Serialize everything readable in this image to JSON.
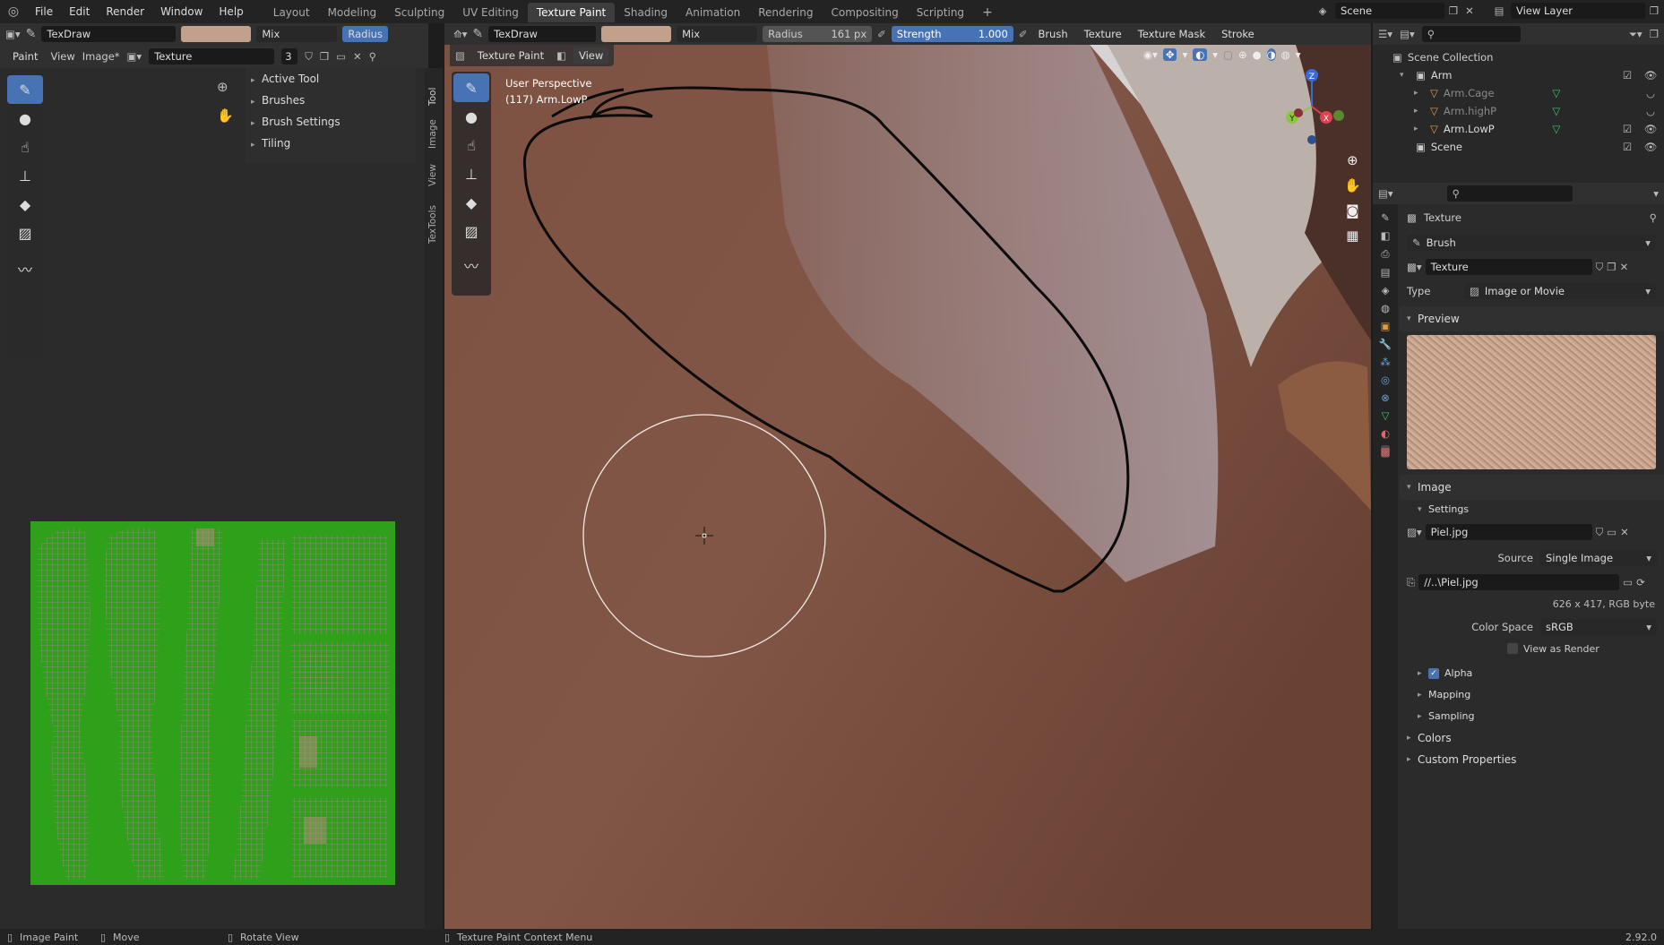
{
  "menu": [
    "File",
    "Edit",
    "Render",
    "Window",
    "Help"
  ],
  "workspaces": [
    "Layout",
    "Modeling",
    "Sculpting",
    "UV Editing",
    "Texture Paint",
    "Shading",
    "Animation",
    "Rendering",
    "Compositing",
    "Scripting"
  ],
  "active_workspace": "Texture Paint",
  "scene_name": "Scene",
  "view_layer": "View Layer",
  "left_toolbar": {
    "brush": "TexDraw",
    "blend": "Mix",
    "radius_btn": "Radius"
  },
  "image_header": {
    "mode": "Paint",
    "view": "View",
    "image": "Image*",
    "texture_name": "Texture",
    "users": "3"
  },
  "tool_panels": [
    "Active Tool",
    "Brushes",
    "Brush Settings",
    "Tiling"
  ],
  "side_tabs": [
    "Tool",
    "Image",
    "View",
    "TexTools"
  ],
  "viewport_toolbar": {
    "brush": "TexDraw",
    "blend": "Mix",
    "radius_label": "Radius",
    "radius_value": "161 px",
    "strength_label": "Strength",
    "strength_value": "1.000",
    "brush_menu": "Brush",
    "texture_menu": "Texture",
    "texture_mask_menu": "Texture Mask",
    "stroke_menu": "Stroke"
  },
  "viewport_header": {
    "mode": "Texture Paint",
    "view": "View"
  },
  "viewport_info": {
    "line1": "User Perspective",
    "line2": "(117) Arm.LowP"
  },
  "gizmo": {
    "x": "X",
    "y": "Y",
    "z": "Z"
  },
  "outliner": {
    "collection": "Scene Collection",
    "items": [
      {
        "name": "Arm",
        "indent": 0,
        "dim": false
      },
      {
        "name": "Arm.Cage",
        "indent": 1,
        "dim": true
      },
      {
        "name": "Arm.highP",
        "indent": 1,
        "dim": true
      },
      {
        "name": "Arm.LowP",
        "indent": 1,
        "dim": false
      },
      {
        "name": "Scene",
        "indent": 0,
        "dim": false
      }
    ]
  },
  "properties": {
    "title": "Texture",
    "context": "Brush",
    "texture_name": "Texture",
    "type_label": "Type",
    "type_value": "Image or Movie",
    "preview": "Preview",
    "image_section": "Image",
    "settings": "Settings",
    "image_name": "Piel.jpg",
    "source_label": "Source",
    "source_value": "Single Image",
    "filepath": "//..\\Piel.jpg",
    "resolution": "626 x 417,  RGB byte",
    "colorspace_label": "Color Space",
    "colorspace_value": "sRGB",
    "view_as_render": "View as Render",
    "alpha": "Alpha",
    "mapping": "Mapping",
    "sampling": "Sampling",
    "colors": "Colors",
    "custom_props": "Custom Properties"
  },
  "status": {
    "image_paint": "Image Paint",
    "move": "Move",
    "rotate": "Rotate View",
    "context": "Texture Paint Context Menu",
    "version": "2.92.0"
  },
  "colors": {
    "accent": "#4772b3",
    "brush_color": "#c1a08c",
    "uv_bg": "#2ea01a"
  }
}
